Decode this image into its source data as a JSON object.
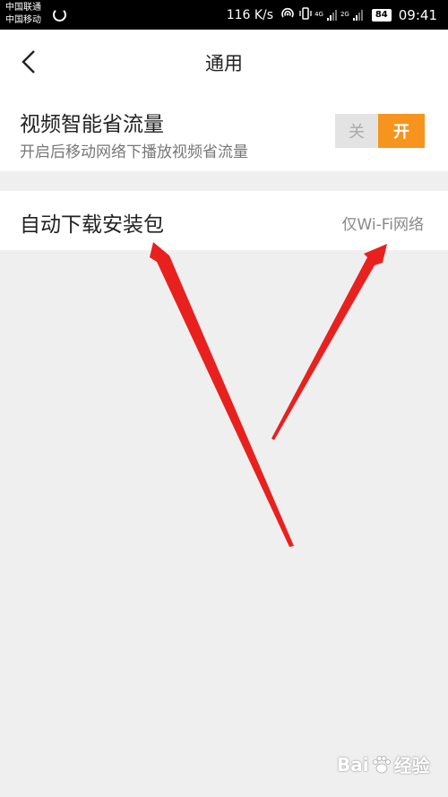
{
  "status_bar": {
    "carrier1": "中国联通",
    "carrier2": "中国移动",
    "speed": "116 K/s",
    "net1": "4G",
    "net2": "2G",
    "battery": "84",
    "time": "09:41"
  },
  "header": {
    "title": "通用"
  },
  "settings": [
    {
      "label": "视频智能省流量",
      "description": "开启后移动网络下播放视频省流量",
      "toggle_off_label": "关",
      "toggle_on_label": "开",
      "state": "on"
    },
    {
      "label": "自动下载安装包",
      "value": "仅Wi-Fi网络"
    }
  ],
  "annotation": {
    "arrow_color": "#e8211f"
  },
  "watermark": {
    "text_left": "Bai",
    "text_right": "经验"
  },
  "colors": {
    "accent": "#f7941d",
    "background": "#efefef"
  }
}
